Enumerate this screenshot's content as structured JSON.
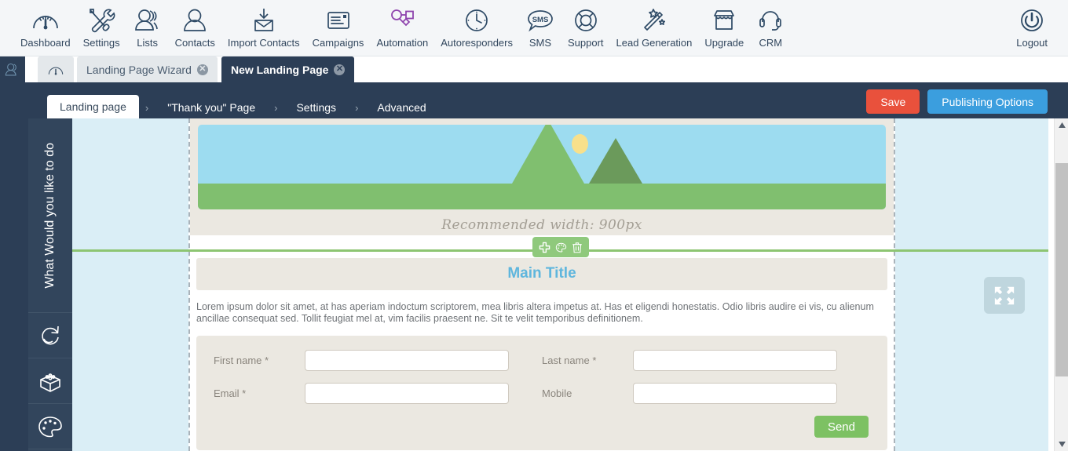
{
  "topnav": {
    "items": [
      {
        "label": "Dashboard",
        "icon": "gauge-icon"
      },
      {
        "label": "Settings",
        "icon": "tools-icon"
      },
      {
        "label": "Lists",
        "icon": "people-group-icon"
      },
      {
        "label": "Contacts",
        "icon": "person-icon"
      },
      {
        "label": "Import Contacts",
        "icon": "import-inbox-icon"
      },
      {
        "label": "Campaigns",
        "icon": "envelope-document-icon"
      },
      {
        "label": "Automation",
        "icon": "workflow-nodes-icon"
      },
      {
        "label": "Autoresponders",
        "icon": "clock-icon"
      },
      {
        "label": "SMS",
        "icon": "sms-bubble-icon"
      },
      {
        "label": "Support",
        "icon": "lifebuoy-icon"
      },
      {
        "label": "Lead Generation",
        "icon": "magic-wand-icon"
      },
      {
        "label": "Upgrade",
        "icon": "storefront-icon"
      },
      {
        "label": "CRM",
        "icon": "headset-icon"
      },
      {
        "label": "Logout",
        "icon": "power-icon"
      }
    ],
    "automation_color": "#8e44ad",
    "icon_color": "#2e4a66"
  },
  "tabs": {
    "left_rail_icon": "people-group-icon",
    "home_tab_icon": "gauge-icon",
    "items": [
      {
        "label": "Landing Page Wizard",
        "active": false,
        "close": "✕"
      },
      {
        "label": "New Landing Page",
        "active": true,
        "close": "✕"
      }
    ]
  },
  "wizard": {
    "steps": [
      {
        "label": "Landing page",
        "active": true
      },
      {
        "label": "\"Thank you\" Page",
        "active": false
      },
      {
        "label": "Settings",
        "active": false
      },
      {
        "label": "Advanced",
        "active": false
      }
    ],
    "separator": "›",
    "save_label": "Save",
    "publish_label": "Publishing Options",
    "save_color": "#e9513c",
    "publish_color": "#3b9ede"
  },
  "sidebar": {
    "vertical_title": "What Would you like to do",
    "buttons": [
      {
        "name": "sync-icon"
      },
      {
        "name": "blocks-box-icon"
      },
      {
        "name": "palette-icon"
      }
    ]
  },
  "editor": {
    "hero": {
      "caption": "Recommended width: 900px",
      "sky_color": "#9ddcf0",
      "ground_color": "#80bf6f",
      "mountain_color": "#6b9a5b",
      "sun_color": "#f8e08b"
    },
    "element_toolbar": {
      "color": "#8fc97c",
      "buttons": [
        {
          "name": "add-plus-icon"
        },
        {
          "name": "palette-icon"
        },
        {
          "name": "trash-icon"
        }
      ]
    },
    "content": {
      "main_title": "Main Title",
      "title_color": "#5fb6dd",
      "paragraph": "Lorem ipsum dolor sit amet, at has aperiam indoctum scriptorem, mea libris altera impetus at. Has et eligendi honestatis. Odio libris audire ei vis, cu alienum ancillae consequat sed. Tollit feugiat mel at, vim facilis praesent ne. Sit te velit temporibus definitionem."
    },
    "form": {
      "fields": [
        {
          "label": "First name *",
          "value": "",
          "placeholder": ""
        },
        {
          "label": "Last name *",
          "value": "",
          "placeholder": ""
        },
        {
          "label": "Email *",
          "value": "",
          "placeholder": ""
        },
        {
          "label": "Mobile",
          "value": "",
          "placeholder": ""
        }
      ],
      "submit_label": "Send",
      "submit_color": "#7dc163"
    },
    "fullscreen_icon": "expand-arrows-icon",
    "guide_line_color": "#8dc572"
  },
  "scrollbar": {
    "up_arrow": "▲",
    "down_arrow": "▼"
  }
}
